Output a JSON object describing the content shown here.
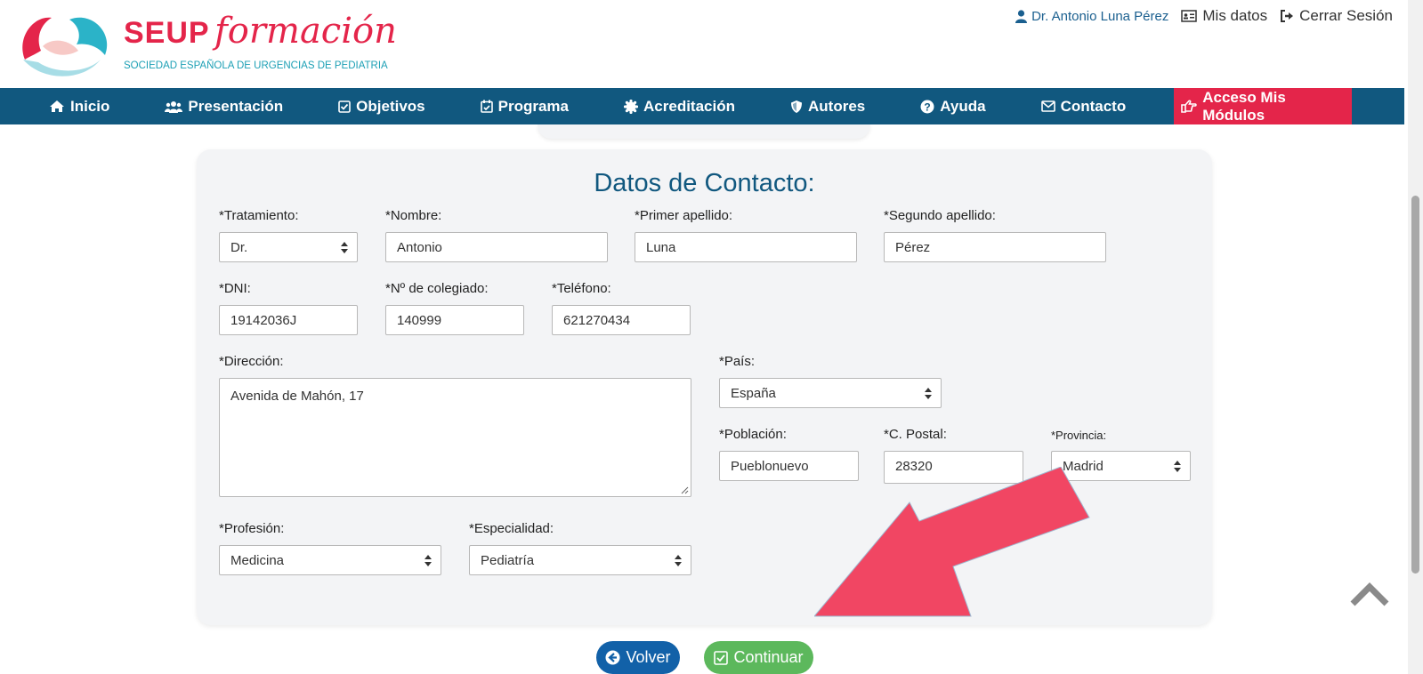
{
  "header": {
    "brand_bold": "SEUP",
    "brand_script": "formación",
    "tagline": "SOCIEDAD ESPAÑOLA DE URGENCIAS DE PEDIATRIA",
    "user_name": "Dr. Antonio Luna Pérez",
    "my_data": "Mis datos",
    "logout": "Cerrar Sesión"
  },
  "nav": {
    "items": [
      {
        "label": "Inicio",
        "icon": "home-icon"
      },
      {
        "label": "Presentación",
        "icon": "users-icon"
      },
      {
        "label": "Objetivos",
        "icon": "check-square-icon"
      },
      {
        "label": "Programa",
        "icon": "calendar-check-icon"
      },
      {
        "label": "Acreditación",
        "icon": "certificate-icon"
      },
      {
        "label": "Autores",
        "icon": "shield-icon"
      },
      {
        "label": "Ayuda",
        "icon": "question-circle-icon"
      },
      {
        "label": "Contacto",
        "icon": "envelope-icon"
      }
    ],
    "access": {
      "label": "Acceso Mis Módulos",
      "icon": "hand-point-right-icon"
    }
  },
  "form": {
    "title": "Datos de Contacto:",
    "tratamiento": {
      "label": "*Tratamiento:",
      "value": "Dr."
    },
    "nombre": {
      "label": "*Nombre:",
      "value": "Antonio"
    },
    "apellido1": {
      "label": "*Primer apellido:",
      "value": "Luna"
    },
    "apellido2": {
      "label": "*Segundo apellido:",
      "value": "Pérez"
    },
    "dni": {
      "label": "*DNI:",
      "value": "19142036J"
    },
    "colegiado": {
      "label": "*Nº de colegiado:",
      "value": "140999"
    },
    "telefono": {
      "label": "*Teléfono:",
      "value": "621270434"
    },
    "direccion": {
      "label": "*Dirección:",
      "value": "Avenida de Mahón, 17"
    },
    "pais": {
      "label": "*País:",
      "value": "España"
    },
    "poblacion": {
      "label": "*Población:",
      "value": "Pueblonuevo"
    },
    "postal": {
      "label": "*C. Postal:",
      "value": "28320"
    },
    "provincia": {
      "label": "*Provincia:",
      "value": "Madrid"
    },
    "profesion": {
      "label": "*Profesión:",
      "value": "Medicina"
    },
    "especialidad": {
      "label": "*Especialidad:",
      "value": "Pediatría"
    }
  },
  "buttons": {
    "back": "Volver",
    "continue": "Continuar"
  },
  "colors": {
    "nav_bg": "#11587f",
    "accent_red": "#e4254a",
    "arrow": "#f14663",
    "continue_green": "#5cb85c",
    "back_blue": "#1261a8"
  }
}
